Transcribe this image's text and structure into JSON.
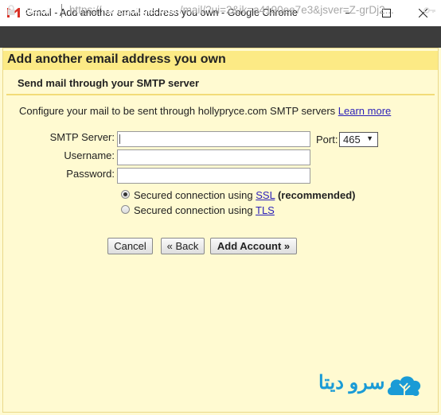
{
  "window": {
    "title": "Gmail - Add another email address you own - Google Chrome",
    "secure_label": "Secure",
    "url_scheme": "https://",
    "url_host": "mail.google.com",
    "url_path": "/mail/?ui=2&ik=a4190ee7e3&jsver=Z-grDj2..."
  },
  "page": {
    "title": "Add another email address you own",
    "section_title": "Send mail through your SMTP server",
    "intro_text": "Configure your mail to be sent through hollypryce.com SMTP servers",
    "learn_more": "Learn more"
  },
  "form": {
    "smtp_label": "SMTP Server:",
    "smtp_value": "",
    "username_label": "Username:",
    "username_value": "",
    "password_label": "Password:",
    "password_value": "",
    "port_label": "Port:",
    "port_value": "465",
    "ssl_prefix": "Secured connection using",
    "ssl_link": "SSL",
    "ssl_suffix": "(recommended)",
    "tls_prefix": "Secured connection using",
    "tls_link": "TLS",
    "selected_security": "SSL"
  },
  "buttons": {
    "cancel": "Cancel",
    "back": "« Back",
    "add_account": "Add Account »"
  },
  "watermark": {
    "text": "سرو دیتا"
  },
  "icons": [
    "gmail-logo-icon",
    "minimize-icon",
    "maximize-icon",
    "close-icon",
    "lock-icon",
    "key-icon",
    "tree-logo-icon"
  ],
  "colors": {
    "page_background": "#fffad1",
    "header_band": "#fcea85",
    "link": "#2a1fb8",
    "watermark": "#1a9bd6"
  }
}
